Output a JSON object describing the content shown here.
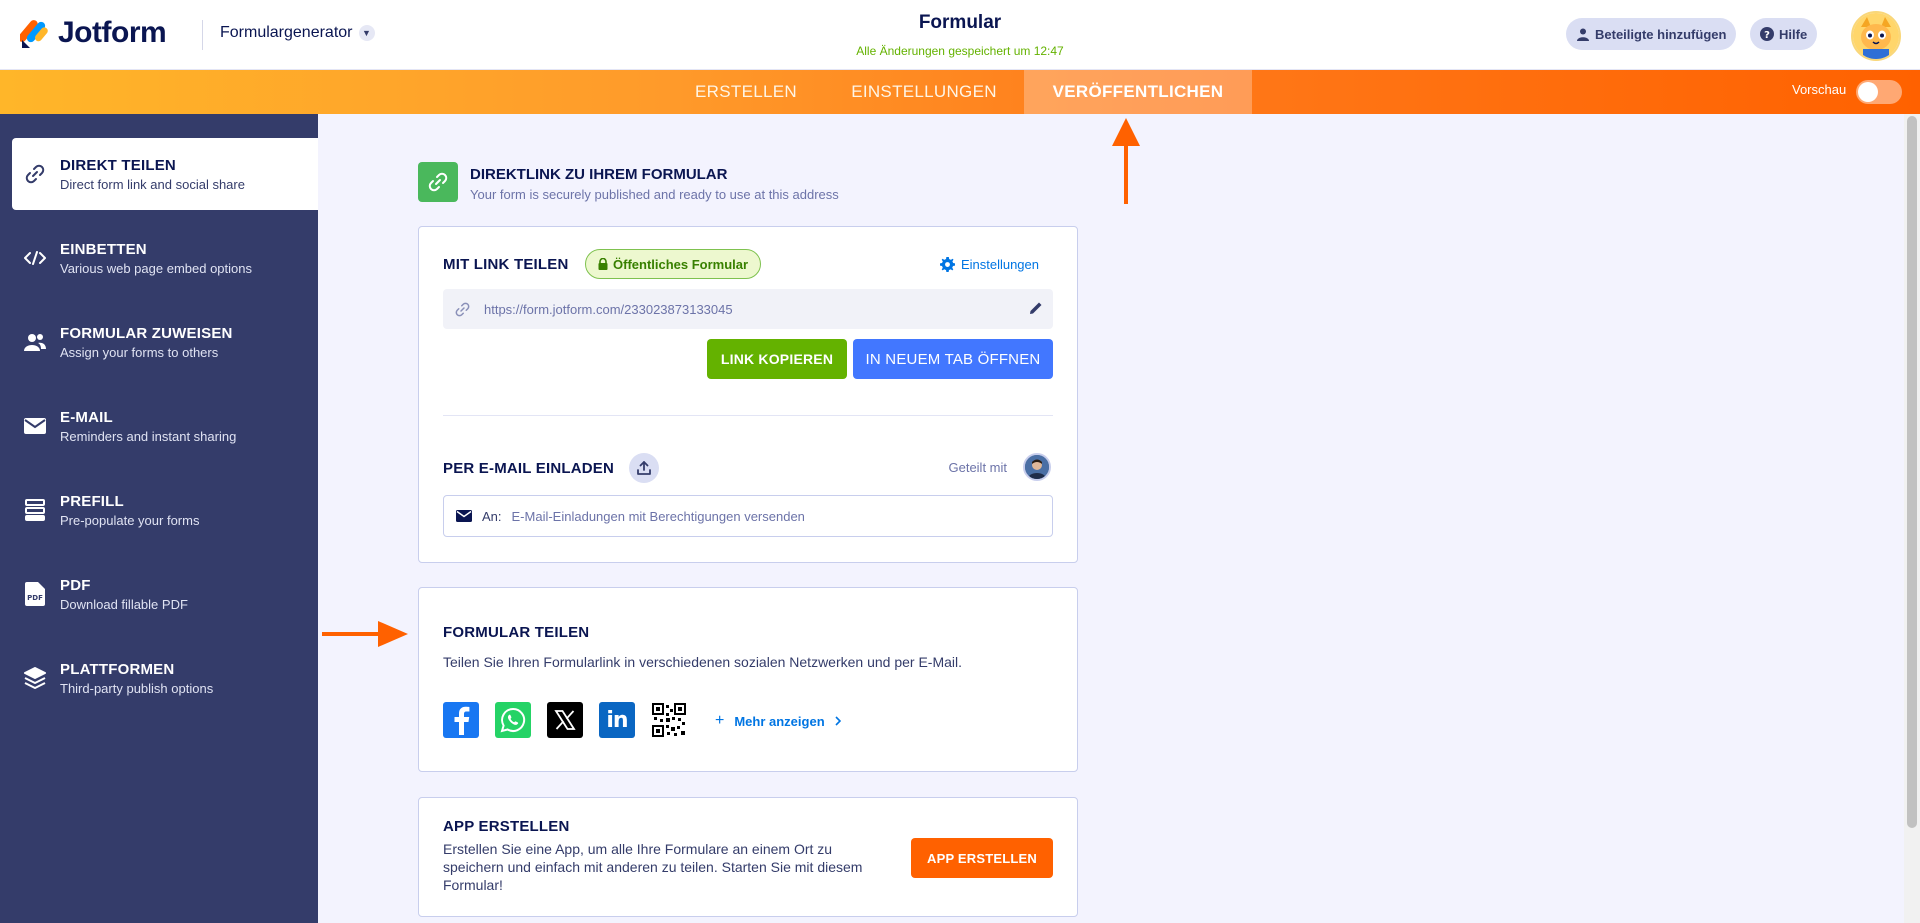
{
  "header": {
    "logo_text": "Jotform",
    "generator_label": "Formulargenerator",
    "form_title": "Formular",
    "saved_status": "Alle Änderungen gespeichert um 12:47",
    "add_participants": "Beteiligte hinzufügen",
    "help": "Hilfe"
  },
  "nav": {
    "tabs": [
      {
        "label": "ERSTELLEN"
      },
      {
        "label": "EINSTELLUNGEN"
      },
      {
        "label": "VERÖFFENTLICHEN"
      }
    ],
    "preview_label": "Vorschau"
  },
  "sidebar": {
    "items": [
      {
        "title": "DIREKT TEILEN",
        "sub": "Direct form link and social share",
        "icon": "link-icon"
      },
      {
        "title": "EINBETTEN",
        "sub": "Various web page embed options",
        "icon": "code-icon"
      },
      {
        "title": "FORMULAR ZUWEISEN",
        "sub": "Assign your forms to others",
        "icon": "users-icon"
      },
      {
        "title": "E-MAIL",
        "sub": "Reminders and instant sharing",
        "icon": "envelope-icon"
      },
      {
        "title": "PREFILL",
        "sub": "Pre-populate your forms",
        "icon": "prefill-icon"
      },
      {
        "title": "PDF",
        "sub": "Download fillable PDF",
        "icon": "pdf-icon",
        "icon_text": "PDF"
      },
      {
        "title": "PLATTFORMEN",
        "sub": "Third-party publish options",
        "icon": "layers-icon"
      }
    ]
  },
  "direct": {
    "title": "DIREKTLINK ZU IHREM FORMULAR",
    "subtitle": "Your form is securely published and ready to use at this address"
  },
  "link_card": {
    "title": "MIT LINK TEILEN",
    "badge": "Öffentliches Formular",
    "settings_label": "Einstellungen",
    "url": "https://form.jotform.com/233023873133045",
    "copy_btn": "LINK KOPIEREN",
    "open_btn": "IN NEUEM TAB ÖFFNEN",
    "email_title": "PER E-MAIL EINLADEN",
    "shared_with": "Geteilt mit",
    "to_label": "An:",
    "email_placeholder": "E-Mail-Einladungen mit Berechtigungen versenden"
  },
  "share_card": {
    "title": "FORMULAR TEILEN",
    "desc": "Teilen Sie Ihren Formularlink in verschiedenen sozialen Netzwerken und per E-Mail.",
    "more_label": "Mehr anzeigen",
    "linkedin_text": "in"
  },
  "app_card": {
    "title": "APP ERSTELLEN",
    "desc": "Erstellen Sie eine App, um alle Ihre Formulare an einem Ort zu speichern und einfach mit anderen zu teilen. Starten Sie mit diesem Formular!",
    "btn": "APP ERSTELLEN"
  },
  "colors": {
    "brand_navy": "#0a1551",
    "sidebar_bg": "#343c6a",
    "accent_orange": "#ff6100",
    "green_button": "#64b200",
    "blue_button": "#4277ff",
    "link_blue": "#0075e3"
  }
}
